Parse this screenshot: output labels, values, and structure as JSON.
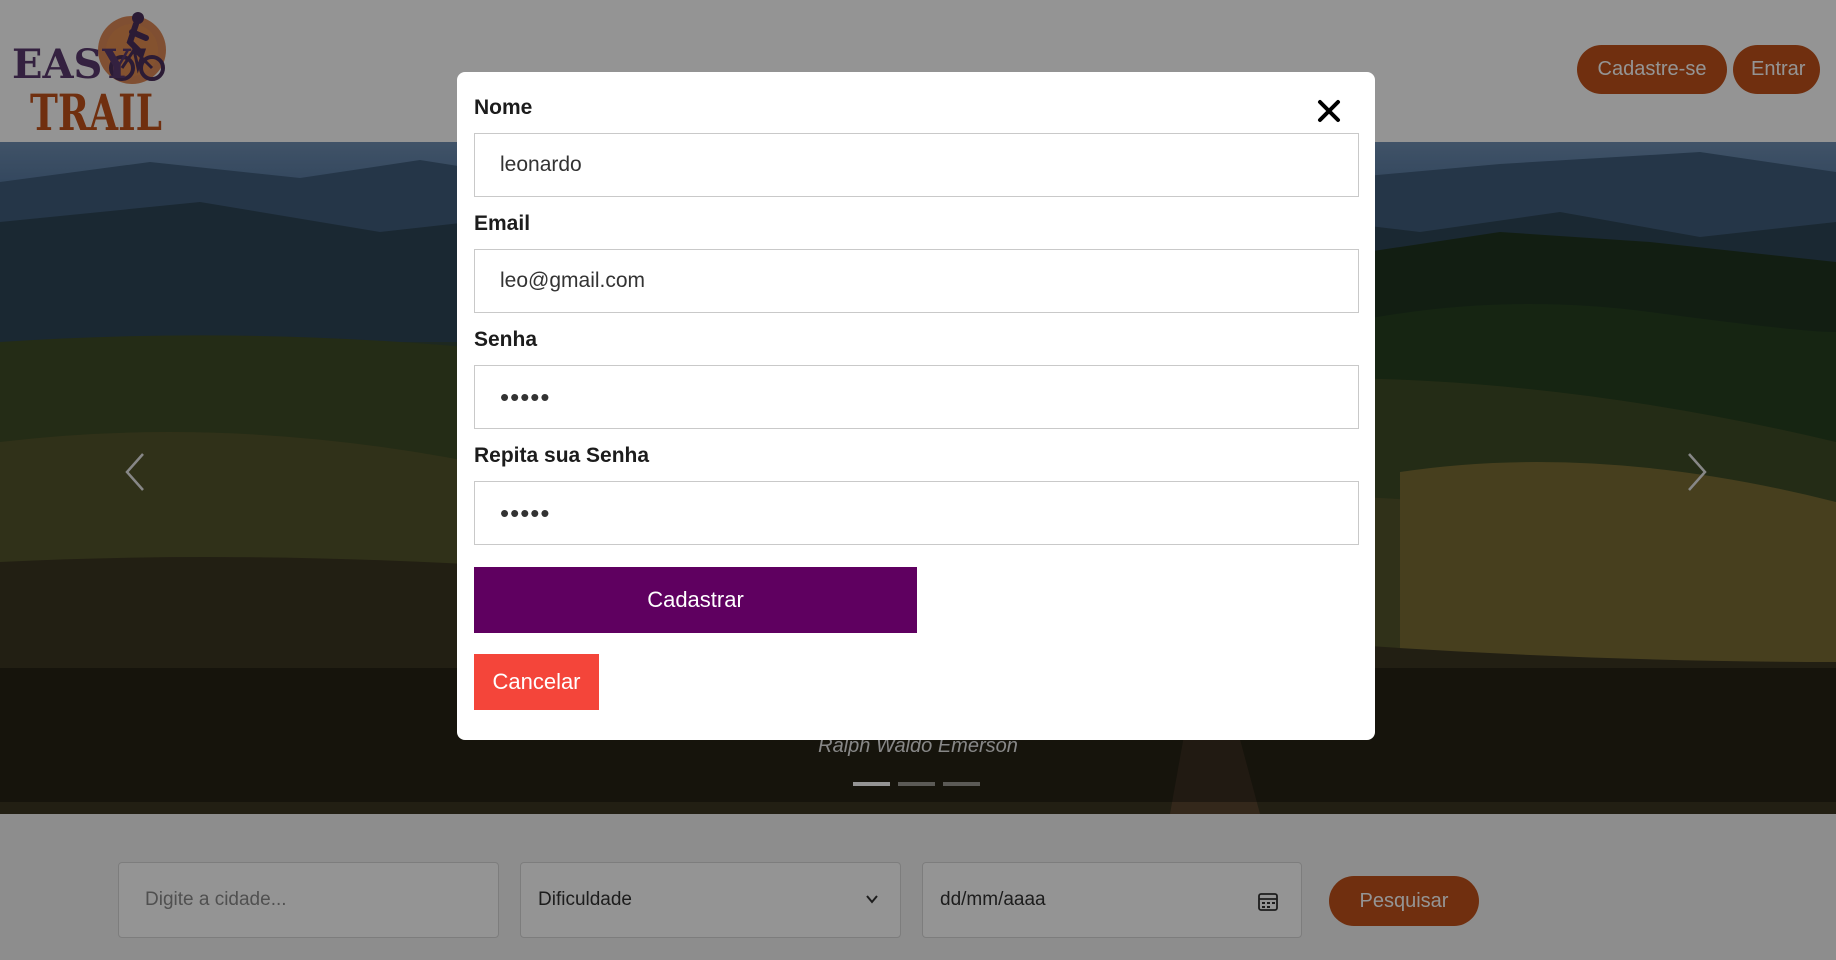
{
  "header": {
    "logo_text_top": "EASY",
    "logo_text_bottom": "TRAIL",
    "signup_label": "Cadastre-se",
    "login_label": "Entrar"
  },
  "carousel": {
    "caption_author": "Ralph Waldo Emerson",
    "slide_count": 3,
    "active_slide": 1
  },
  "search": {
    "city_placeholder": "Digite a cidade...",
    "difficulty_value": "Dificuldade",
    "date_placeholder": "dd/mm/aaaa",
    "search_label": "Pesquisar"
  },
  "modal": {
    "name_label": "Nome",
    "name_value": "leonardo",
    "email_label": "Email",
    "email_value": "leo@gmail.com",
    "password_label": "Senha",
    "password_value": "•••••",
    "repeat_password_label": "Repita sua Senha",
    "repeat_password_value": "•••••",
    "submit_label": "Cadastrar",
    "cancel_label": "Cancelar"
  },
  "colors": {
    "brand_orange": "#c2521a",
    "submit_purple": "#5f0060",
    "cancel_red": "#f4453a",
    "logo_purple": "#5a3a6e"
  }
}
